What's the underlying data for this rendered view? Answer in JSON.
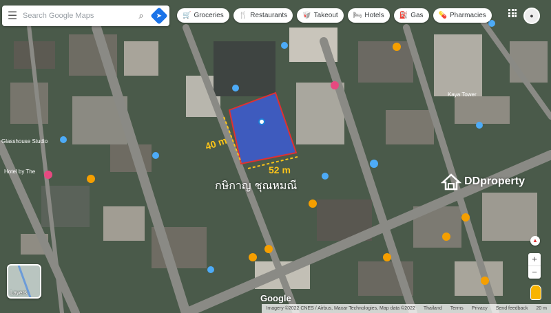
{
  "search": {
    "placeholder": "Search Google Maps",
    "menu_icon": "hamburger-menu-icon",
    "search_icon": "search-icon",
    "directions_icon": "directions-icon"
  },
  "chips": [
    {
      "label": "Groceries",
      "icon": "shopping-cart-icon",
      "glyph": "🛒"
    },
    {
      "label": "Restaurants",
      "icon": "fork-knife-icon",
      "glyph": "🍴"
    },
    {
      "label": "Takeout",
      "icon": "takeout-icon",
      "glyph": "🥡"
    },
    {
      "label": "Hotels",
      "icon": "bed-icon",
      "glyph": "🛏"
    },
    {
      "label": "Gas",
      "icon": "gas-pump-icon",
      "glyph": "⛽"
    },
    {
      "label": "Pharmacies",
      "icon": "pharmacy-icon",
      "glyph": "💊"
    }
  ],
  "plot": {
    "width_label": "40 m",
    "length_label": "52 m",
    "fill_color": "#3b5bdb",
    "border_color": "#e03131",
    "dimension_color": "#fcc419"
  },
  "owner_text": "กษิกาญ ชุณหมณี",
  "watermark": {
    "brand": "DDproperty",
    "icon": "house-logo-icon"
  },
  "map_labels": [
    {
      "text": "Glasshouse Studio"
    },
    {
      "text": "Hotel by The"
    },
    {
      "text": "Kaya Tower"
    }
  ],
  "layers": {
    "label": "Layers",
    "icon": "layers-icon"
  },
  "google_logo": "Google",
  "attribution": [
    "Imagery ©2022 CNES / Airbus, Maxar Technologies, Map data ©2022",
    "Thailand",
    "Terms",
    "Privacy",
    "Send feedback",
    "20 m"
  ],
  "zoom": {
    "in": "+",
    "out": "−"
  },
  "colors": {
    "pin_orange": "#f59f00",
    "pin_blue": "#4dabf7",
    "pin_pink": "#e64980",
    "road": "#8a8a85"
  }
}
